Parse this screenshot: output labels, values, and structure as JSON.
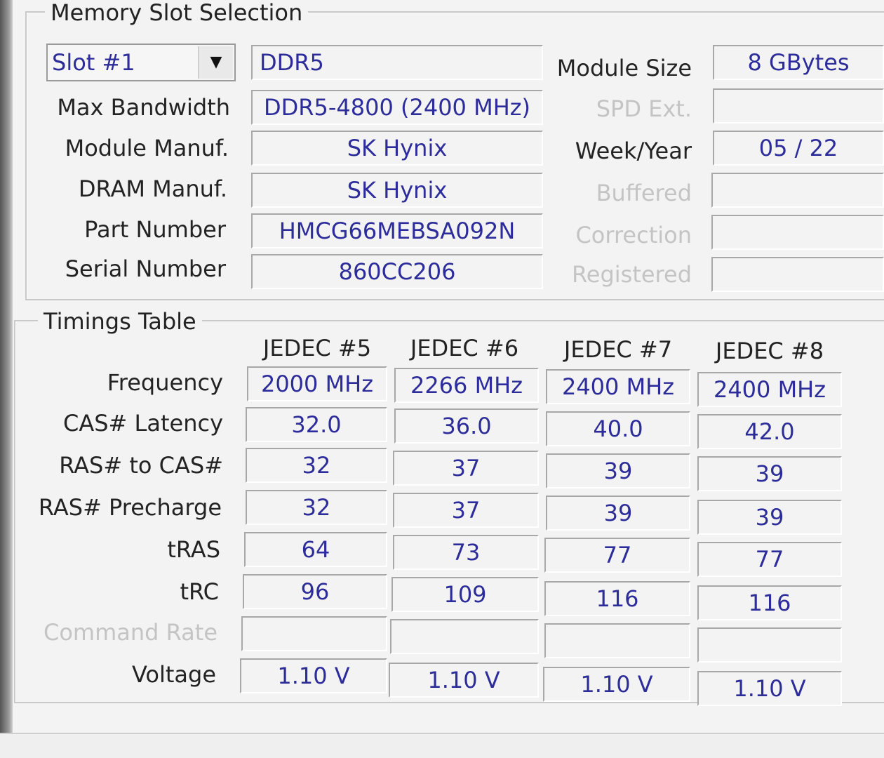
{
  "memory_slot": {
    "title": "Memory Slot Selection",
    "slot": "Slot #1",
    "type": "DDR5",
    "module_size_label": "Module Size",
    "module_size": "8 GBytes",
    "max_bandwidth_label": "Max Bandwidth",
    "max_bandwidth": "DDR5-4800 (2400 MHz)",
    "spd_ext_label": "SPD Ext.",
    "spd_ext": "",
    "module_manuf_label": "Module Manuf.",
    "module_manuf": "SK Hynix",
    "week_year_label": "Week/Year",
    "week_year": "05 / 22",
    "dram_manuf_label": "DRAM Manuf.",
    "dram_manuf": "SK Hynix",
    "buffered_label": "Buffered",
    "buffered": "",
    "part_number_label": "Part Number",
    "part_number": "HMCG66MEBSA092N",
    "correction_label": "Correction",
    "correction": "",
    "serial_number_label": "Serial Number",
    "serial_number": "860CC206",
    "registered_label": "Registered",
    "registered": ""
  },
  "timings": {
    "title": "Timings Table",
    "columns": [
      "JEDEC #5",
      "JEDEC #6",
      "JEDEC #7",
      "JEDEC #8"
    ],
    "rows": [
      {
        "label": "Frequency",
        "values": [
          "2000 MHz",
          "2266 MHz",
          "2400 MHz",
          "2400 MHz"
        ]
      },
      {
        "label": "CAS# Latency",
        "values": [
          "32.0",
          "36.0",
          "40.0",
          "42.0"
        ]
      },
      {
        "label": "RAS# to CAS#",
        "values": [
          "32",
          "37",
          "39",
          "39"
        ]
      },
      {
        "label": "RAS# Precharge",
        "values": [
          "32",
          "37",
          "39",
          "39"
        ]
      },
      {
        "label": "tRAS",
        "values": [
          "64",
          "73",
          "77",
          "77"
        ]
      },
      {
        "label": "tRC",
        "values": [
          "96",
          "109",
          "116",
          "116"
        ]
      },
      {
        "label": "Command Rate",
        "values": [
          "",
          "",
          "",
          ""
        ]
      },
      {
        "label": "Voltage",
        "values": [
          "1.10 V",
          "1.10 V",
          "1.10 V",
          "1.10 V"
        ]
      }
    ]
  }
}
